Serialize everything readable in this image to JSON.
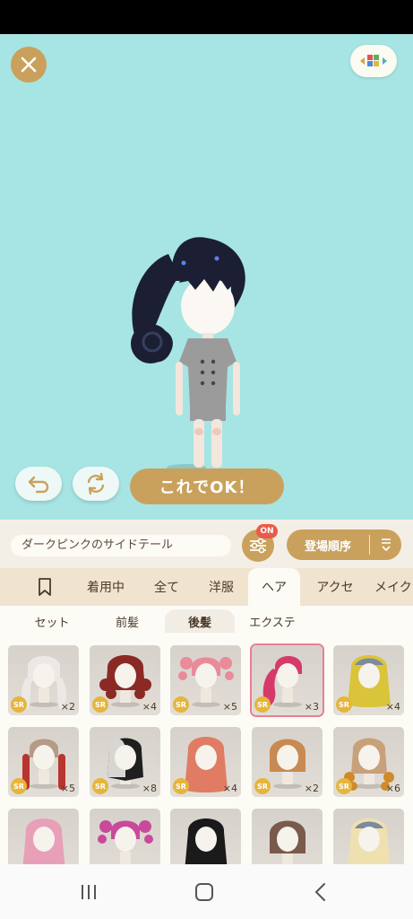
{
  "toolbar": {
    "ok_label": "これでOK！"
  },
  "item": {
    "name": "ダークピンクのサイドテール"
  },
  "filter": {
    "badge": "ON"
  },
  "sort": {
    "label": "登場順序"
  },
  "tabs": [
    "着用中",
    "全て",
    "洋服",
    "ヘア",
    "アクセ",
    "メイク"
  ],
  "active_tab": "ヘア",
  "subtabs": [
    "セット",
    "前髪",
    "後髪",
    "エクステ"
  ],
  "active_subtab": "後髪",
  "items": [
    {
      "rarity": "SR",
      "count": "×2",
      "hair_color": "#ece8e6",
      "style": "twin-long"
    },
    {
      "rarity": "SR",
      "count": "×4",
      "hair_color": "#8b2a24",
      "style": "curly"
    },
    {
      "rarity": "SR",
      "count": "×5",
      "hair_color": "#e98b99",
      "style": "buns"
    },
    {
      "rarity": "SR",
      "count": "×3",
      "hair_color": "#d53a6a",
      "style": "side-tail",
      "selected": true
    },
    {
      "rarity": "SR",
      "count": "×4",
      "hair_color": "#d9c43a",
      "style": "wavy"
    },
    {
      "rarity": "SR",
      "count": "×5",
      "hair_color": "#b9352f",
      "style": "braids"
    },
    {
      "rarity": "SR",
      "count": "×8",
      "hair_color": "#1f1f1f",
      "style": "half"
    },
    {
      "rarity": "SR",
      "count": "×4",
      "hair_color": "#e07c64",
      "style": "long"
    },
    {
      "rarity": "SR",
      "count": "×2",
      "hair_color": "#c88a52",
      "style": "bob"
    },
    {
      "rarity": "SR",
      "count": "×6",
      "hair_color": "#cf8a2a",
      "style": "curl-ends"
    },
    {
      "rarity": "",
      "count": "",
      "hair_color": "#e8a0b8",
      "style": "long"
    },
    {
      "rarity": "",
      "count": "",
      "hair_color": "#c94a9a",
      "style": "buns"
    },
    {
      "rarity": "",
      "count": "",
      "hair_color": "#1a1a1a",
      "style": "long"
    },
    {
      "rarity": "",
      "count": "",
      "hair_color": "#7a5a4a",
      "style": "bob"
    },
    {
      "rarity": "",
      "count": "",
      "hair_color": "#efe0b0",
      "style": "wavy"
    }
  ],
  "colors": {
    "stage_bg": "#a6e5e3",
    "accent_gold": "#c9a15c",
    "badge_red": "#e85b4a",
    "selected_pink": "#ec7d95"
  },
  "icons": [
    "close-icon",
    "palette-icon",
    "undo-icon",
    "rotate-icon",
    "filter-sliders-icon",
    "sort-order-icon",
    "bookmark-icon",
    "recent-apps-icon",
    "home-icon",
    "back-icon"
  ]
}
